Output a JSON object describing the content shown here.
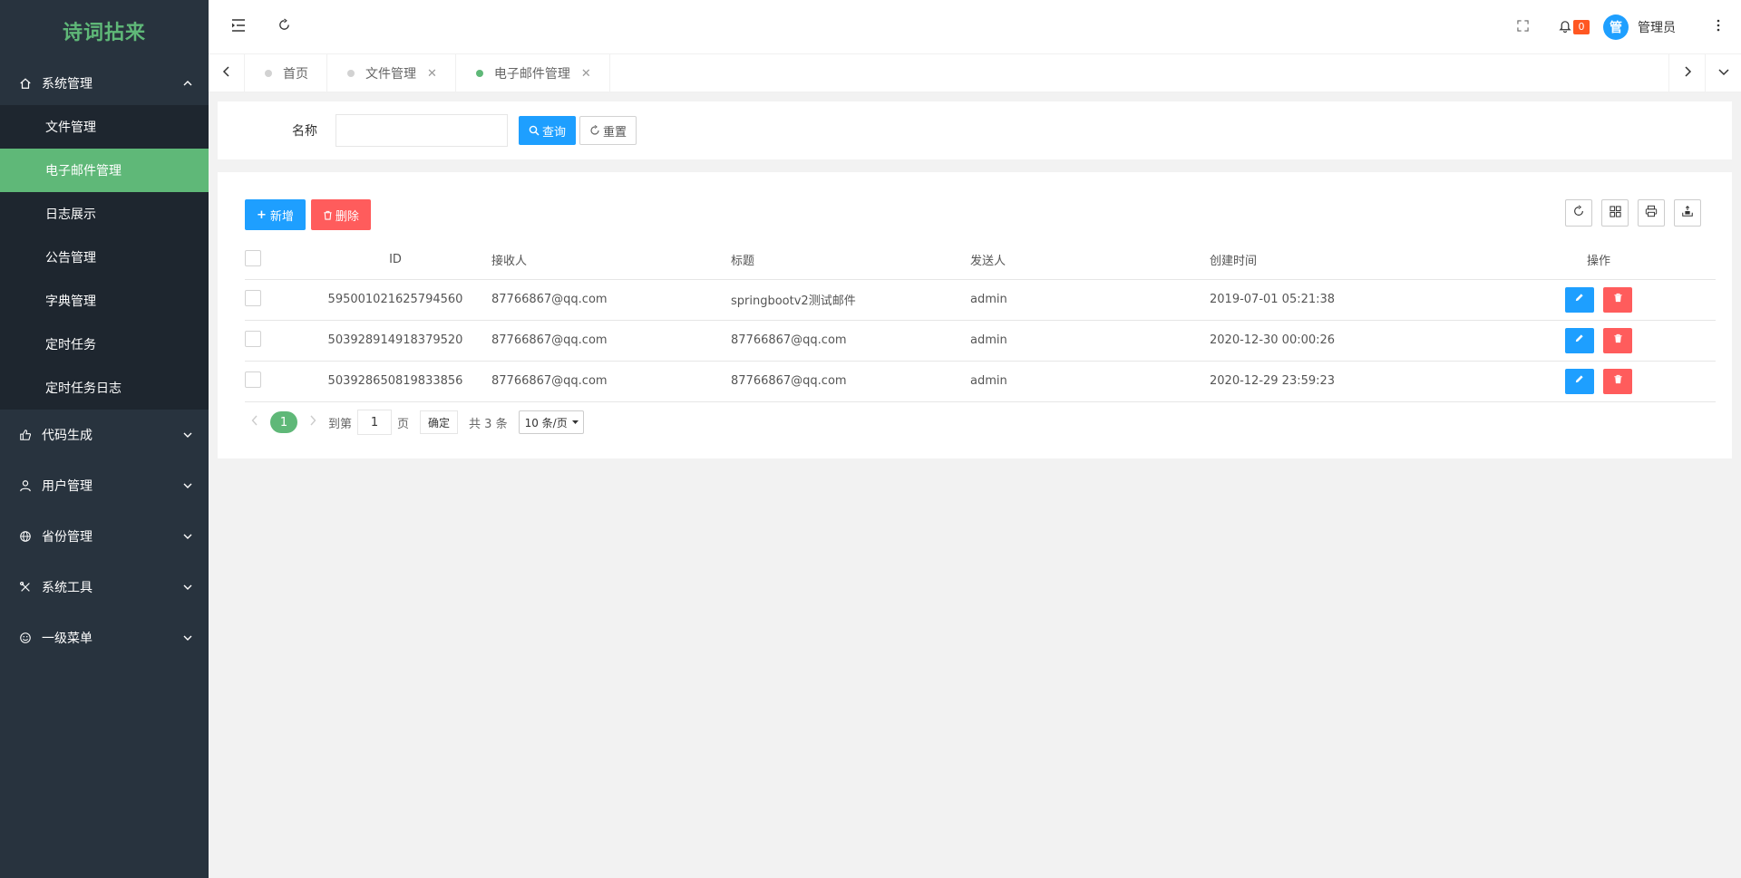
{
  "app": {
    "logo": "诗词拈来"
  },
  "sidebar": {
    "groups": [
      {
        "label": "系统管理",
        "icon": "home-icon",
        "expanded": true,
        "items": [
          {
            "label": "文件管理"
          },
          {
            "label": "电子邮件管理",
            "active": true
          },
          {
            "label": "日志展示"
          },
          {
            "label": "公告管理"
          },
          {
            "label": "字典管理"
          },
          {
            "label": "定时任务"
          },
          {
            "label": "定时任务日志"
          }
        ]
      },
      {
        "label": "代码生成",
        "icon": "thumb-icon"
      },
      {
        "label": "用户管理",
        "icon": "user-icon"
      },
      {
        "label": "省份管理",
        "icon": "globe-icon"
      },
      {
        "label": "系统工具",
        "icon": "tools-icon"
      },
      {
        "label": "一级菜单",
        "icon": "smile-icon"
      }
    ]
  },
  "header": {
    "notification_count": "0",
    "avatar_text": "管",
    "username": "管理员"
  },
  "tabs": [
    {
      "label": "首页",
      "closable": false
    },
    {
      "label": "文件管理",
      "closable": true
    },
    {
      "label": "电子邮件管理",
      "closable": true,
      "active": true
    }
  ],
  "search": {
    "name_label": "名称",
    "name_value": "",
    "query_label": "查询",
    "reset_label": "重置"
  },
  "toolbar": {
    "add_label": "新增",
    "delete_label": "删除"
  },
  "table": {
    "columns": [
      "ID",
      "接收人",
      "标题",
      "发送人",
      "创建时间",
      "操作"
    ],
    "rows": [
      {
        "id": "595001021625794560",
        "receiver": "87766867@qq.com",
        "title": "springbootv2测试邮件",
        "sender": "admin",
        "created": "2019-07-01 05:21:38"
      },
      {
        "id": "503928914918379520",
        "receiver": "87766867@qq.com",
        "title": "87766867@qq.com",
        "sender": "admin",
        "created": "2020-12-30 00:00:26"
      },
      {
        "id": "503928650819833856",
        "receiver": "87766867@qq.com",
        "title": "87766867@qq.com",
        "sender": "admin",
        "created": "2020-12-29 23:59:23"
      }
    ]
  },
  "pagination": {
    "current_page": "1",
    "goto_label": "到第",
    "goto_value": "1",
    "page_unit": "页",
    "confirm_label": "确定",
    "total_text": "共 3 条",
    "page_size": "10 条/页"
  },
  "colors": {
    "sidebar_bg": "#28333e",
    "submenu_bg": "#1e262f",
    "accent_green": "#5fb878",
    "primary_blue": "#1e9fff",
    "danger_red": "#ff5c5c",
    "badge_orange": "#ff5722"
  }
}
